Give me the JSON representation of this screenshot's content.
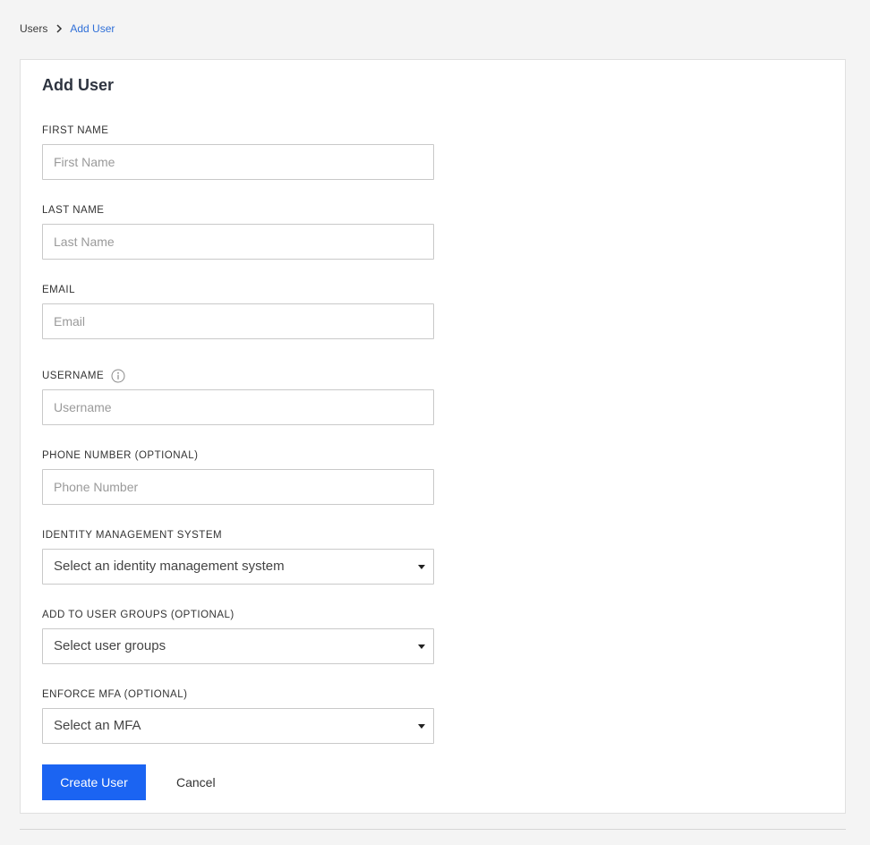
{
  "breadcrumb": {
    "parent": "Users",
    "current": "Add User"
  },
  "form": {
    "title": "Add User",
    "first_name": {
      "label": "FIRST NAME",
      "placeholder": "First Name",
      "value": ""
    },
    "last_name": {
      "label": "LAST NAME",
      "placeholder": "Last Name",
      "value": ""
    },
    "email": {
      "label": "EMAIL",
      "placeholder": "Email",
      "value": ""
    },
    "username": {
      "label": "USERNAME",
      "placeholder": "Username",
      "value": ""
    },
    "phone": {
      "label": "PHONE NUMBER (OPTIONAL)",
      "placeholder": "Phone Number",
      "value": ""
    },
    "identity_system": {
      "label": "IDENTITY MANAGEMENT SYSTEM",
      "selected": "Select an identity management system"
    },
    "user_groups": {
      "label": "ADD TO USER GROUPS (OPTIONAL)",
      "selected": "Select user groups"
    },
    "mfa": {
      "label": "ENFORCE MFA (OPTIONAL)",
      "selected": "Select an MFA"
    }
  },
  "actions": {
    "create_label": "Create User",
    "cancel_label": "Cancel"
  },
  "icons": {
    "breadcrumb_separator": "chevron-right-icon",
    "username_info": "info-icon",
    "select_caret": "caret-down-icon"
  },
  "colors": {
    "primary": "#1b64f2",
    "link": "#2f6fd8",
    "background": "#f4f4f4"
  }
}
